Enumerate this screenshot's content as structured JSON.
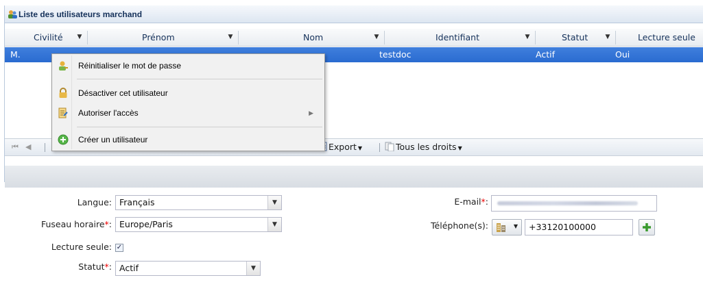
{
  "panel": {
    "title": "Liste des utilisateurs marchand"
  },
  "grid": {
    "columns": [
      "Civilité",
      "Prénom",
      "Nom",
      "Identifiant",
      "Statut",
      "Lecture seule"
    ],
    "selected_row": {
      "civilite": "M.",
      "identifiant": "testdoc",
      "statut": "Actif",
      "lecture_seule": "Oui"
    }
  },
  "toolbar": {
    "export_label": "Export",
    "rights_label": "Tous les droits"
  },
  "context_menu": {
    "items": [
      {
        "label": "Réinitialiser le mot de passe",
        "icon": "key-user-icon"
      },
      {
        "label": "Désactiver cet utilisateur",
        "icon": "lock-icon"
      },
      {
        "label": "Autoriser l'accès",
        "icon": "access-icon",
        "submenu": true
      },
      {
        "label": "Créer un utilisateur",
        "icon": "add-circle-icon"
      }
    ]
  },
  "form": {
    "langue_label": "Langue:",
    "langue_value": "Français",
    "fuseau_label": "Fuseau horaire",
    "fuseau_value": "Europe/Paris",
    "lecture_seule_label": "Lecture seule:",
    "lecture_seule_checked": true,
    "statut_label": "Statut",
    "statut_value": "Actif",
    "email_label": "E-mail",
    "telephone_label": "Téléphone(s):",
    "telephone_value": "+33120100000"
  },
  "colors": {
    "accent": "#2a6bd0",
    "required": "#ee0000"
  }
}
